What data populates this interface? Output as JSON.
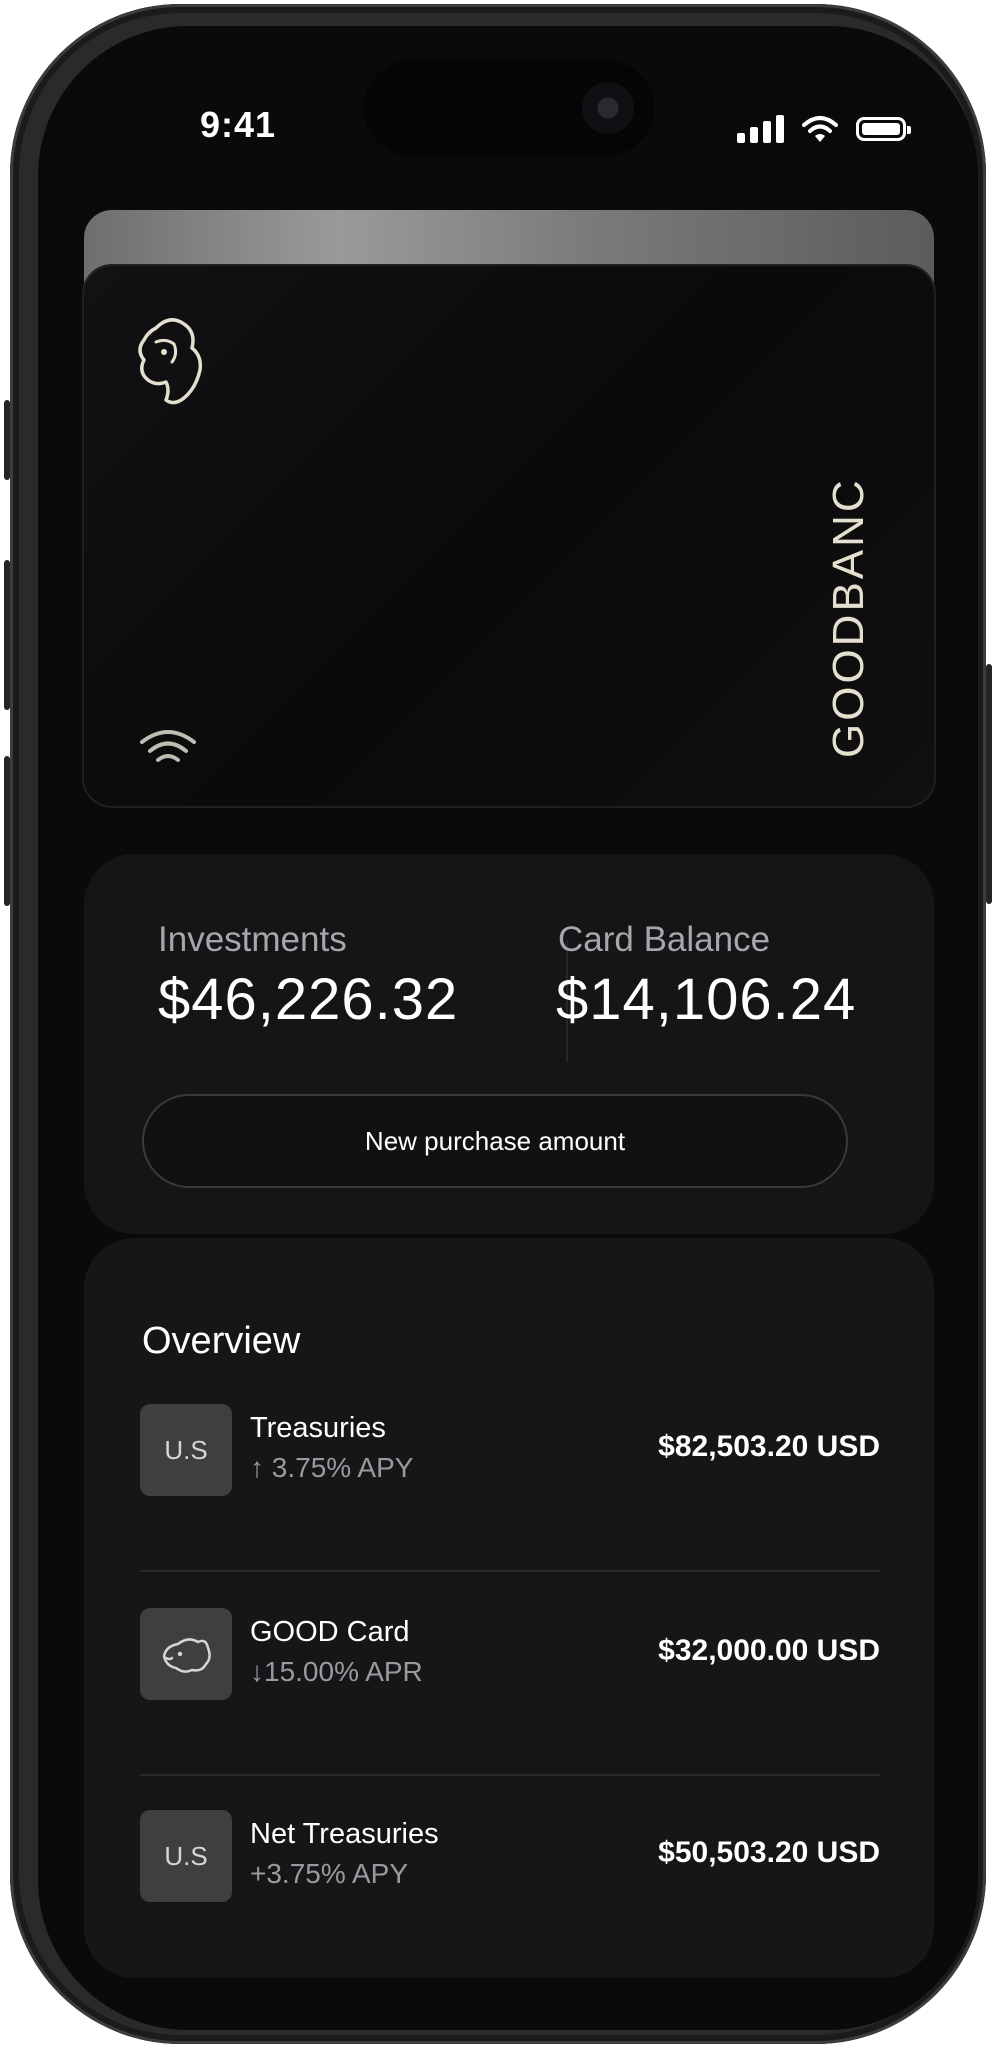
{
  "status_bar": {
    "time": "9:41"
  },
  "card": {
    "brand": "GOODBANC"
  },
  "balances": {
    "investments_label": "Investments",
    "investments_value": "$46,226.32",
    "card_balance_label": "Card Balance",
    "card_balance_value": "$14,106.24",
    "purchase_button": "New purchase amount"
  },
  "overview": {
    "title": "Overview",
    "items": [
      {
        "icon_text": "U.S",
        "name": "Treasuries",
        "rate": "↑ 3.75% APY",
        "amount": "$82,503.20 USD"
      },
      {
        "icon": "dog-head-icon",
        "name": "GOOD Card",
        "rate": "↓15.00% APR",
        "amount": "$32,000.00 USD"
      },
      {
        "icon_text": "U.S",
        "name": "Net Treasuries",
        "rate": "+3.75% APY",
        "amount": "$50,503.20 USD"
      }
    ]
  }
}
